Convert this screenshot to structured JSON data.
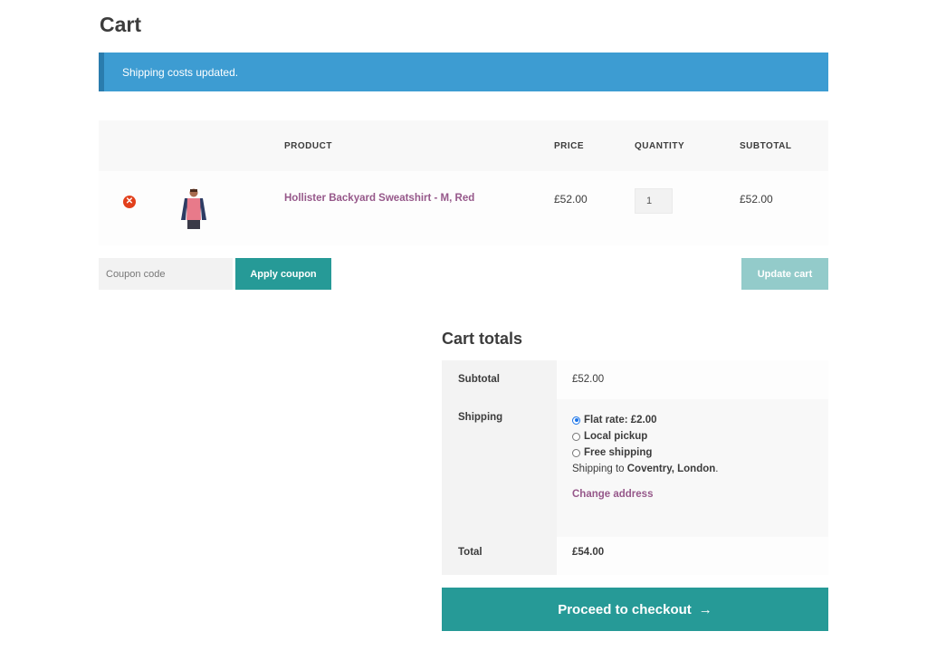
{
  "page": {
    "title": "Cart"
  },
  "notice": {
    "message": "Shipping costs updated."
  },
  "cart_table": {
    "headers": {
      "product": "PRODUCT",
      "price": "PRICE",
      "quantity": "QUANTITY",
      "subtotal": "SUBTOTAL"
    },
    "items": [
      {
        "name": "Hollister Backyard Sweatshirt - M, Red",
        "price": "£52.00",
        "quantity": "1",
        "subtotal": "£52.00",
        "remove_icon": "remove-circle-icon"
      }
    ]
  },
  "coupon": {
    "placeholder": "Coupon code",
    "apply_label": "Apply coupon"
  },
  "update_label": "Update cart",
  "totals": {
    "title": "Cart totals",
    "subtotal_label": "Subtotal",
    "subtotal_value": "£52.00",
    "shipping_label": "Shipping",
    "shipping_options": [
      {
        "label": "Flat rate: £2.00",
        "selected": true
      },
      {
        "label": "Local pickup",
        "selected": false
      },
      {
        "label": "Free shipping",
        "selected": false
      }
    ],
    "shipping_to_prefix": "Shipping to",
    "shipping_to_location": "Coventry, London",
    "change_address": "Change address",
    "total_label": "Total",
    "total_value": "£54.00"
  },
  "checkout": {
    "label": "Proceed to checkout",
    "arrow": "→"
  },
  "colors": {
    "notice": "#3d9cd2",
    "primary_button": "#269a97",
    "disabled_button": "#93cbca",
    "link": "#96588a",
    "remove": "#e2401c"
  }
}
